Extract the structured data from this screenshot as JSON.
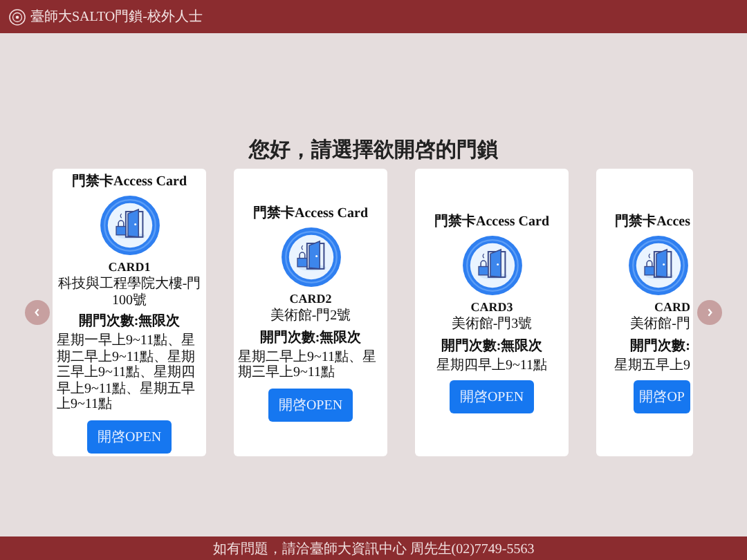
{
  "header": {
    "title": "臺師大SALTO門鎖-校外人士"
  },
  "heading": "您好，請選擇欲開啓的門鎖",
  "cards": [
    {
      "kind": "full",
      "label": "門禁卡Access Card",
      "card_id": "CARD1",
      "door": "科技與工程學院大樓-門100號",
      "count": "開門次數:無限次",
      "schedule": "星期一早上9~11點、星期二早上9~11點、星期三早上9~11點、星期四早上9~11點、星期五早上9~11點",
      "button": "開啓OPEN"
    },
    {
      "kind": "full",
      "label": "門禁卡Access Card",
      "card_id": "CARD2",
      "door": "美術館-門2號",
      "count": "開門次數:無限次",
      "schedule": "星期二早上9~11點、星期三早上9~11點",
      "button": "開啓OPEN"
    },
    {
      "kind": "full",
      "label": "門禁卡Access Card",
      "card_id": "CARD3",
      "door": "美術館-門3號",
      "count": "開門次數:無限次",
      "schedule": "星期四早上9~11點",
      "button": "開啓OPEN"
    },
    {
      "kind": "cut",
      "label": "門禁卡Acces",
      "card_id": "CARD",
      "door": "美術館-門",
      "count": "開門次數:",
      "schedule": "星期五早上9",
      "button": "開啓OP"
    }
  ],
  "footer": "如有問題，請洽臺師大資訊中心 周先生(02)7749-5563"
}
